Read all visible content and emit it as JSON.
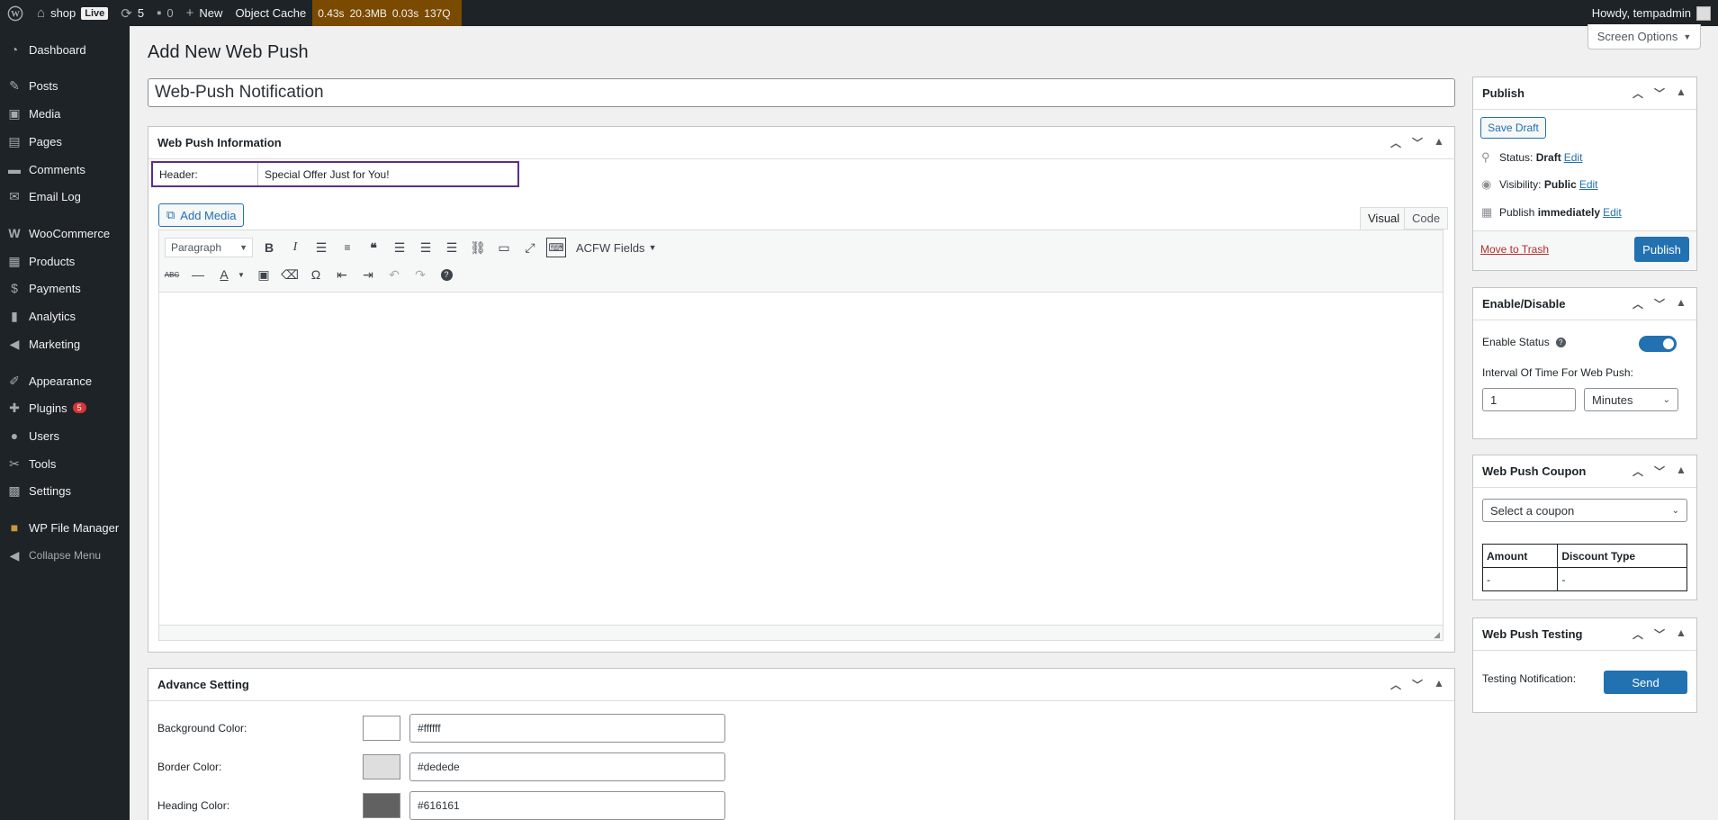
{
  "admin_bar": {
    "wp_logo_icon": "wordpress-icon",
    "site_name": "shop",
    "live_badge": "Live",
    "updates_count": "5",
    "comments_count": "0",
    "new_label": "New",
    "object_cache": "Object Cache",
    "perf": [
      "0.43s",
      "20.3MB",
      "0.03s",
      "137Q"
    ],
    "howdy": "Howdy, tempadmin"
  },
  "sidebar": {
    "items": [
      {
        "label": "Dashboard",
        "icon": "dashboard-icon"
      },
      {
        "label": "Posts",
        "icon": "pin-icon"
      },
      {
        "label": "Media",
        "icon": "media-icon"
      },
      {
        "label": "Pages",
        "icon": "pages-icon"
      },
      {
        "label": "Comments",
        "icon": "comment-icon"
      },
      {
        "label": "Email Log",
        "icon": "email-icon"
      },
      {
        "label": "WooCommerce",
        "icon": "woo-icon"
      },
      {
        "label": "Products",
        "icon": "archive-icon"
      },
      {
        "label": "Payments",
        "icon": "payment-icon"
      },
      {
        "label": "Analytics",
        "icon": "chart-icon"
      },
      {
        "label": "Marketing",
        "icon": "megaphone-icon"
      },
      {
        "label": "Appearance",
        "icon": "brush-icon"
      },
      {
        "label": "Plugins",
        "icon": "plugin-icon",
        "badge": "5"
      },
      {
        "label": "Users",
        "icon": "user-icon"
      },
      {
        "label": "Tools",
        "icon": "wrench-icon"
      },
      {
        "label": "Settings",
        "icon": "settings-icon"
      },
      {
        "label": "WP File Manager",
        "icon": "folder-icon"
      },
      {
        "label": "Collapse Menu",
        "icon": "collapse-icon"
      }
    ]
  },
  "page": {
    "title": "Add New Web Push",
    "screen_options": "Screen Options",
    "post_title": "Web-Push Notification"
  },
  "web_push_info": {
    "title": "Web Push Information",
    "header_label": "Header:",
    "header_value": "Special Offer Just for You!",
    "add_media": "Add Media",
    "tab_visual": "Visual",
    "tab_code": "Code",
    "format_select": "Paragraph",
    "acfw_fields": "ACFW Fields"
  },
  "advance_setting": {
    "title": "Advance Setting",
    "rows": [
      {
        "label": "Background Color:",
        "value": "#ffffff",
        "swatch": "#ffffff"
      },
      {
        "label": "Border Color:",
        "value": "#dedede",
        "swatch": "#dedede"
      },
      {
        "label": "Heading Color:",
        "value": "#616161",
        "swatch": "#616161"
      }
    ]
  },
  "publish": {
    "title": "Publish",
    "save_draft": "Save Draft",
    "status_label": "Status:",
    "status_value": "Draft",
    "visibility_label": "Visibility:",
    "visibility_value": "Public",
    "publish_label": "Publish",
    "publish_value": "immediately",
    "edit": "Edit",
    "move_to_trash": "Move to Trash",
    "publish_button": "Publish"
  },
  "enable_disable": {
    "title": "Enable/Disable",
    "enable_status": "Enable Status",
    "help": "?",
    "interval_label": "Interval Of Time For Web Push:",
    "interval_value": "1",
    "interval_unit": "Minutes",
    "enabled": true
  },
  "coupon": {
    "title": "Web Push Coupon",
    "select_placeholder": "Select a coupon",
    "headers": [
      "Amount",
      "Discount Type"
    ],
    "row": [
      "-",
      "-"
    ]
  },
  "testing": {
    "title": "Web Push Testing",
    "label": "Testing Notification:",
    "send": "Send"
  }
}
